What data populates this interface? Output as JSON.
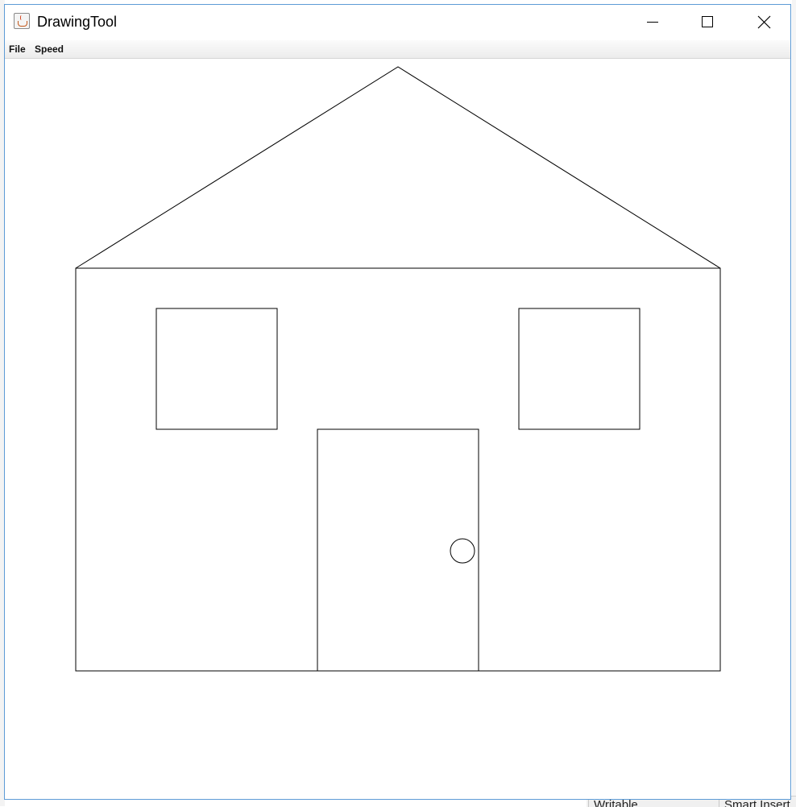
{
  "window": {
    "title": "DrawingTool",
    "icon": "java-cup-icon",
    "controls": [
      "minimize-icon",
      "maximize-icon",
      "close-icon"
    ]
  },
  "menubar": {
    "items": [
      {
        "label": "File"
      },
      {
        "label": "Speed"
      }
    ]
  },
  "background": {
    "status_writable": "Writable",
    "status_insert": "Smart Insert"
  },
  "drawing": {
    "subject": "house",
    "stroke_color": "#000000",
    "shapes": [
      "roof",
      "house-body",
      "left-window",
      "right-window",
      "door",
      "door-knob"
    ]
  }
}
